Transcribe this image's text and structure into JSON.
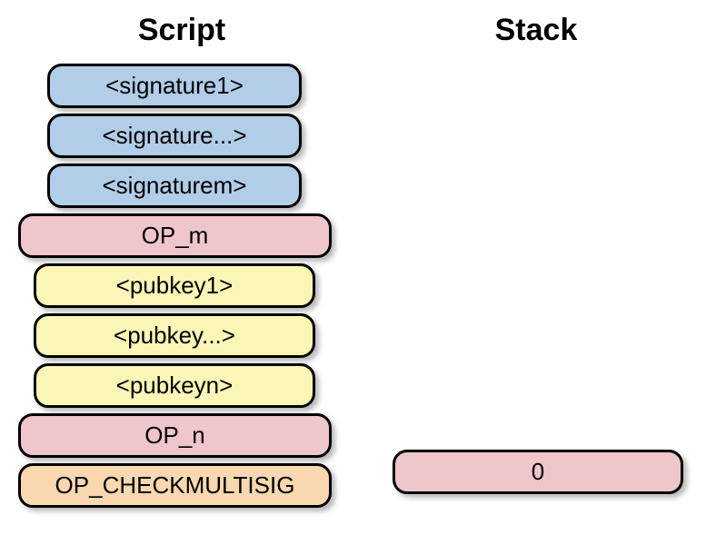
{
  "titles": {
    "script": "Script",
    "stack": "Stack"
  },
  "script_items": [
    {
      "kind": "sig",
      "label": "<signature1>"
    },
    {
      "kind": "sig",
      "label": "<signature...>"
    },
    {
      "kind": "sig",
      "label": "<signaturem>"
    },
    {
      "kind": "op",
      "label": "OP_m"
    },
    {
      "kind": "pub",
      "label": "<pubkey1>"
    },
    {
      "kind": "pub",
      "label": "<pubkey...>"
    },
    {
      "kind": "pub",
      "label": "<pubkeyn>"
    },
    {
      "kind": "op",
      "label": "OP_n"
    },
    {
      "kind": "check",
      "label": "OP_CHECKMULTISIG"
    }
  ],
  "stack_items": [
    {
      "kind": "op",
      "label": "0"
    }
  ],
  "colors": {
    "sig": "#b1cde8",
    "op": "#eec6cc",
    "pub": "#fbf5b6",
    "check": "#f9d8af"
  }
}
